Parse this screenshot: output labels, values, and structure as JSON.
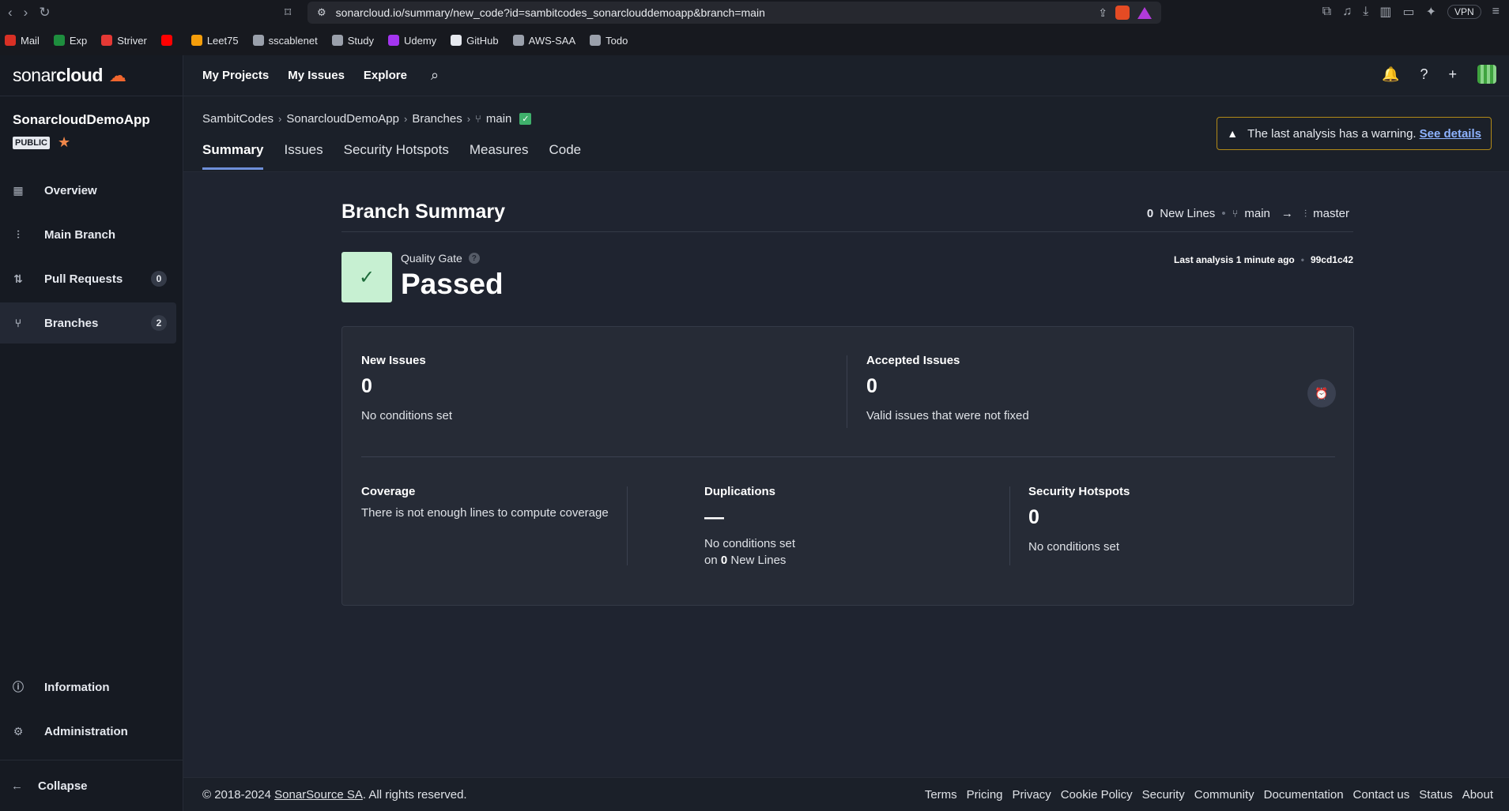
{
  "browser": {
    "url": "sonarcloud.io/summary/new_code?id=sambitcodes_sonarclouddemoapp&branch=main",
    "vpn_label": "VPN",
    "bookmarks": [
      {
        "label": "Mail",
        "color": "#d93025"
      },
      {
        "label": "Exp",
        "color": "#1e8e3e"
      },
      {
        "label": "Striver",
        "color": "#e53935"
      },
      {
        "label": "",
        "color": "#ff0000"
      },
      {
        "label": "Leet75",
        "color": "#f59e0b"
      },
      {
        "label": "sscablenet",
        "color": "#9aa0ab"
      },
      {
        "label": "Study",
        "color": "#9aa0ab"
      },
      {
        "label": "Udemy",
        "color": "#a435f0"
      },
      {
        "label": "GitHub",
        "color": "#e6e9ef"
      },
      {
        "label": "AWS-SAA",
        "color": "#9aa0ab"
      },
      {
        "label": "Todo",
        "color": "#9aa0ab"
      }
    ]
  },
  "brand": {
    "logo_light": "sonar",
    "logo_bold": "cloud",
    "accent": "#f0662e"
  },
  "project": {
    "name": "SonarcloudDemoApp",
    "visibility": "PUBLIC"
  },
  "sidebar": {
    "items": [
      {
        "label": "Overview",
        "icon": "grid-icon",
        "count": ""
      },
      {
        "label": "Main Branch",
        "icon": "branch-icon",
        "count": ""
      },
      {
        "label": "Pull Requests",
        "icon": "pull-request-icon",
        "count": "0"
      },
      {
        "label": "Branches",
        "icon": "branches-icon",
        "count": "2"
      }
    ],
    "bottom": [
      {
        "label": "Information",
        "icon": "info-icon"
      },
      {
        "label": "Administration",
        "icon": "gear-icon"
      }
    ],
    "collapse": "Collapse"
  },
  "topnav": {
    "links": [
      "My Projects",
      "My Issues",
      "Explore"
    ]
  },
  "breadcrumb": {
    "org": "SambitCodes",
    "project": "SonarcloudDemoApp",
    "branches": "Branches",
    "branch": "main"
  },
  "tabs": [
    "Summary",
    "Issues",
    "Security Hotspots",
    "Measures",
    "Code"
  ],
  "warning": {
    "text": "The last analysis has a warning.",
    "link": "See details"
  },
  "summary": {
    "title": "Branch Summary",
    "new_lines_count": "0",
    "new_lines_label": "New Lines",
    "branch": "main",
    "target": "master",
    "quality_gate_label": "Quality Gate",
    "quality_gate_status": "Passed",
    "last_analysis": "Last analysis 1 minute ago",
    "commit": "99cd1c42"
  },
  "metrics": {
    "new_issues": {
      "title": "New Issues",
      "value": "0",
      "sub": "No conditions set"
    },
    "accepted_issues": {
      "title": "Accepted Issues",
      "value": "0",
      "sub": "Valid issues that were not fixed"
    },
    "coverage": {
      "title": "Coverage",
      "sub": "There is not enough lines to compute coverage"
    },
    "duplications": {
      "title": "Duplications",
      "value": "—",
      "sub": "No conditions set",
      "sub2_prefix": "on",
      "sub2_count": "0",
      "sub2_suffix": "New Lines"
    },
    "hotspots": {
      "title": "Security Hotspots",
      "value": "0",
      "sub": "No conditions set"
    }
  },
  "footer": {
    "copyright_prefix": "© 2018-2024",
    "company": "SonarSource SA",
    "copyright_suffix": ". All rights reserved.",
    "links": [
      "Terms",
      "Pricing",
      "Privacy",
      "Cookie Policy",
      "Security",
      "Community",
      "Documentation",
      "Contact us",
      "Status",
      "About"
    ]
  }
}
